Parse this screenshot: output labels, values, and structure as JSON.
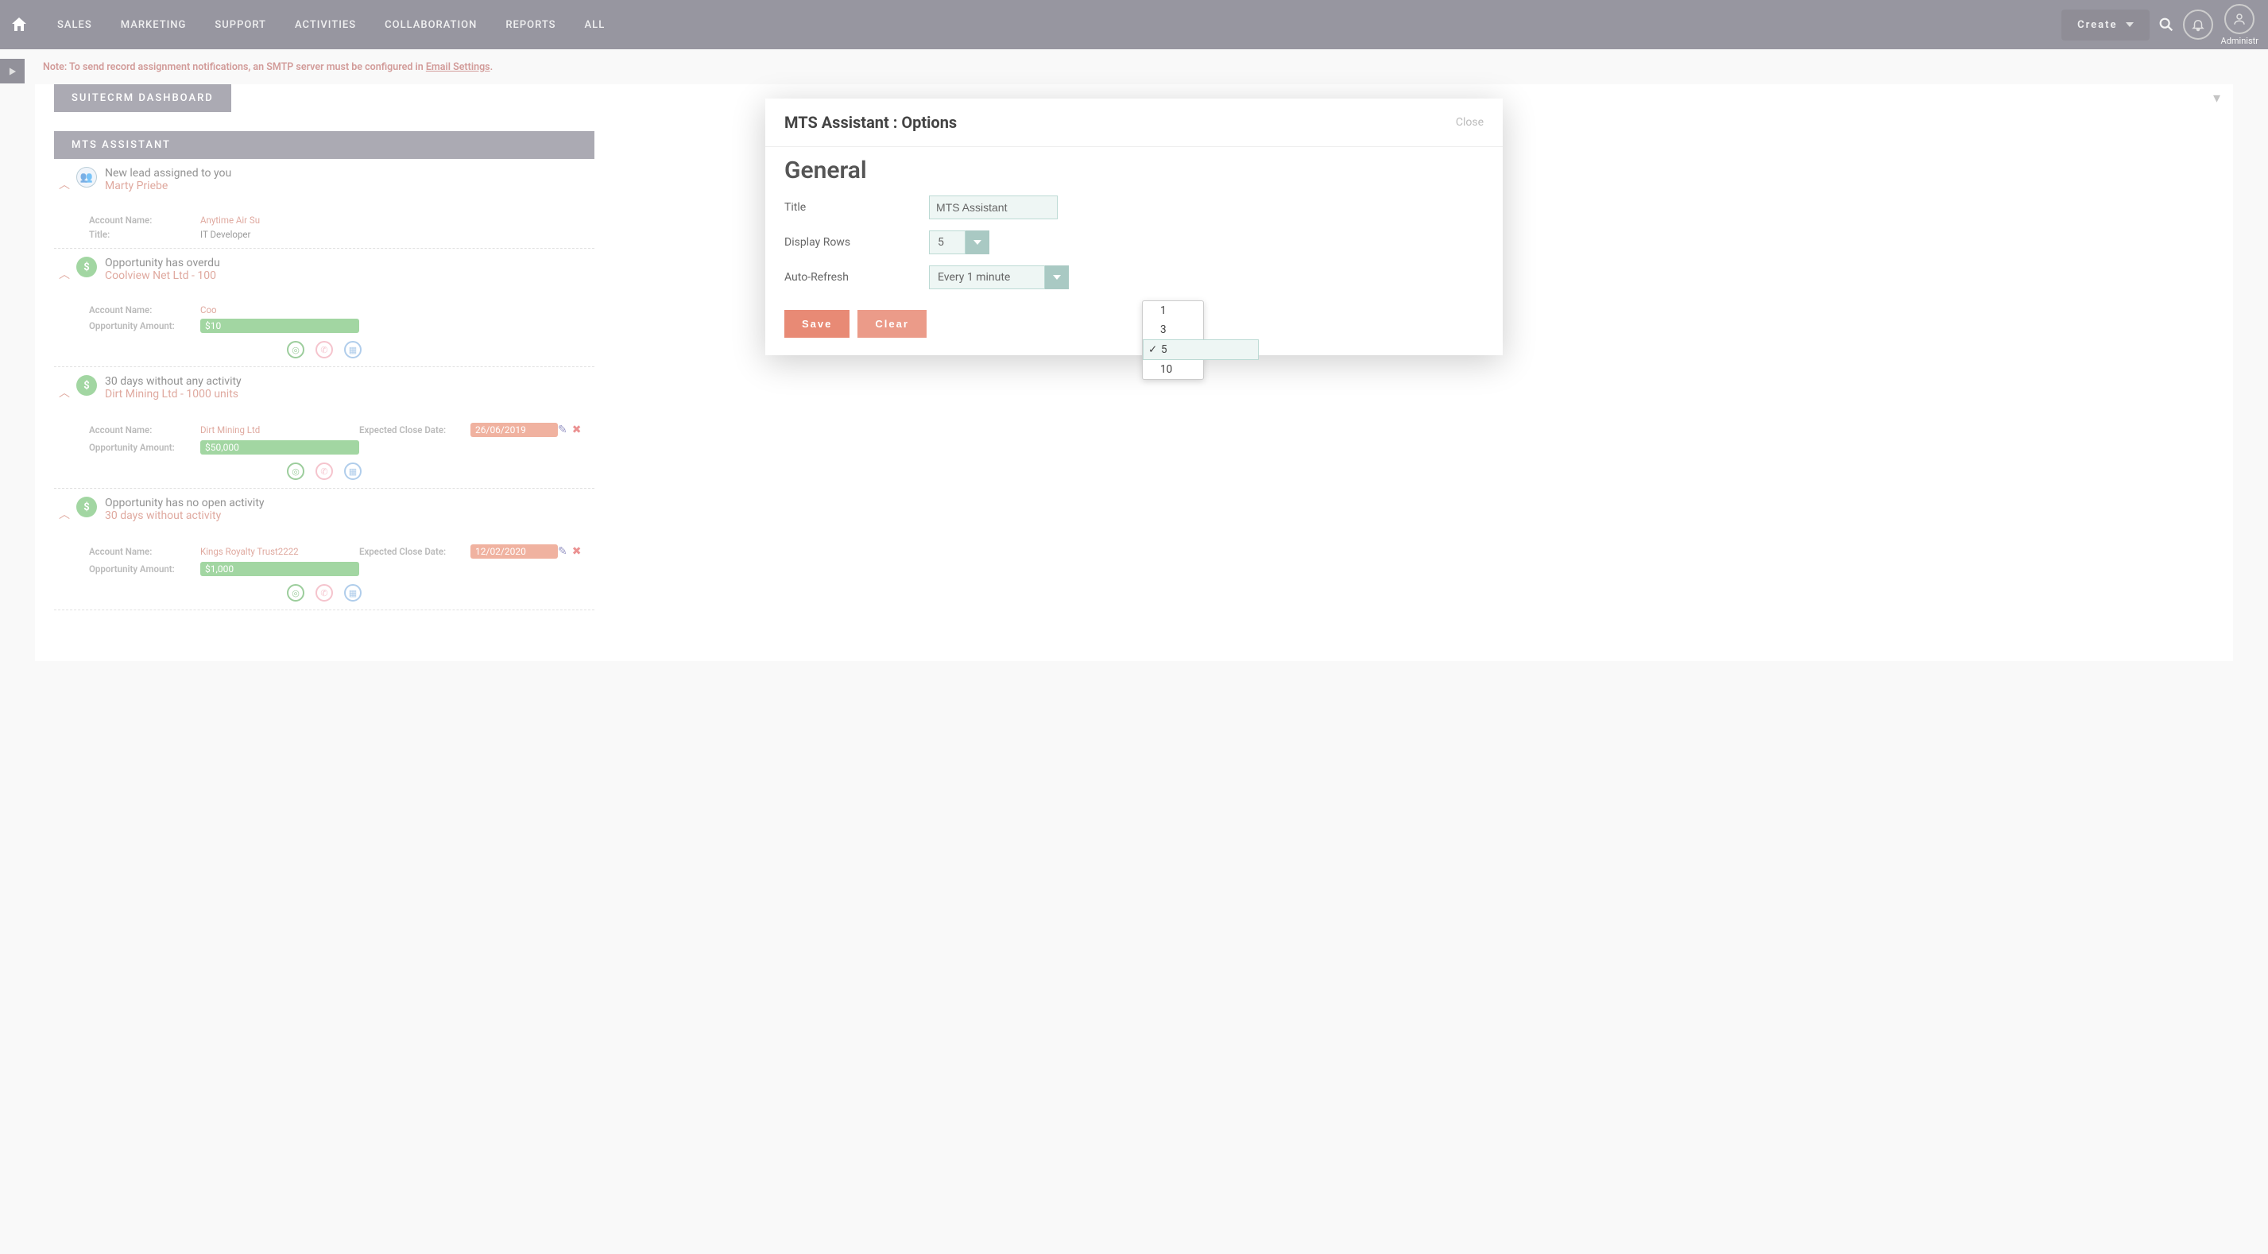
{
  "nav": {
    "items": [
      "Sales",
      "Marketing",
      "Support",
      "Activities",
      "Collaboration",
      "Reports",
      "All"
    ],
    "create": "Create",
    "user_label": "Administr"
  },
  "note": {
    "prefix": "Note: To send record assignment notifications, an SMTP server must be configured in ",
    "link": "Email Settings",
    "suffix": "."
  },
  "dashboard": {
    "tab": "SuiteCRM Dashboard",
    "card_title": "MTS Assistant"
  },
  "items": [
    {
      "type": "New lead assigned to you",
      "name": "Marty Priebe",
      "account_lbl": "Account Name:",
      "account": "Anytime Air Su",
      "title_lbl": "Title:",
      "title": "IT Developer"
    },
    {
      "type": "Opportunity has overdu",
      "name": "Coolview Net Ltd - 100",
      "account_lbl": "Account Name:",
      "account": "Coo",
      "amt_lbl": "Opportunity Amount:",
      "amt": "$10"
    },
    {
      "type": "30 days without any activity",
      "name": "Dirt Mining Ltd - 1000 units",
      "account_lbl": "Account Name:",
      "account": "Dirt Mining Ltd",
      "amt_lbl": "Opportunity Amount:",
      "amt": "$50,000",
      "close_lbl": "Expected Close Date:",
      "close": "26/06/2019"
    },
    {
      "type": "Opportunity has no open activity",
      "name": "30 days without activity",
      "account_lbl": "Account Name:",
      "account": "Kings Royalty Trust2222",
      "amt_lbl": "Opportunity Amount:",
      "amt": "$1,000",
      "close_lbl": "Expected Close Date:",
      "close": "12/02/2020"
    }
  ],
  "modal": {
    "title": "MTS Assistant : Options",
    "close": "Close",
    "section": "General",
    "title_lbl": "Title",
    "title_val": "MTS Assistant",
    "rows_lbl": "Display Rows",
    "rows_val": "5",
    "refresh_lbl": "Auto-Refresh",
    "refresh_val": "Every 1 minute",
    "save": "Save",
    "clear": "Clear"
  },
  "dropdown": {
    "options": [
      "1",
      "3",
      "5",
      "10"
    ],
    "selected": "5"
  },
  "icons": {
    "lead": "👥",
    "opp": "$"
  }
}
